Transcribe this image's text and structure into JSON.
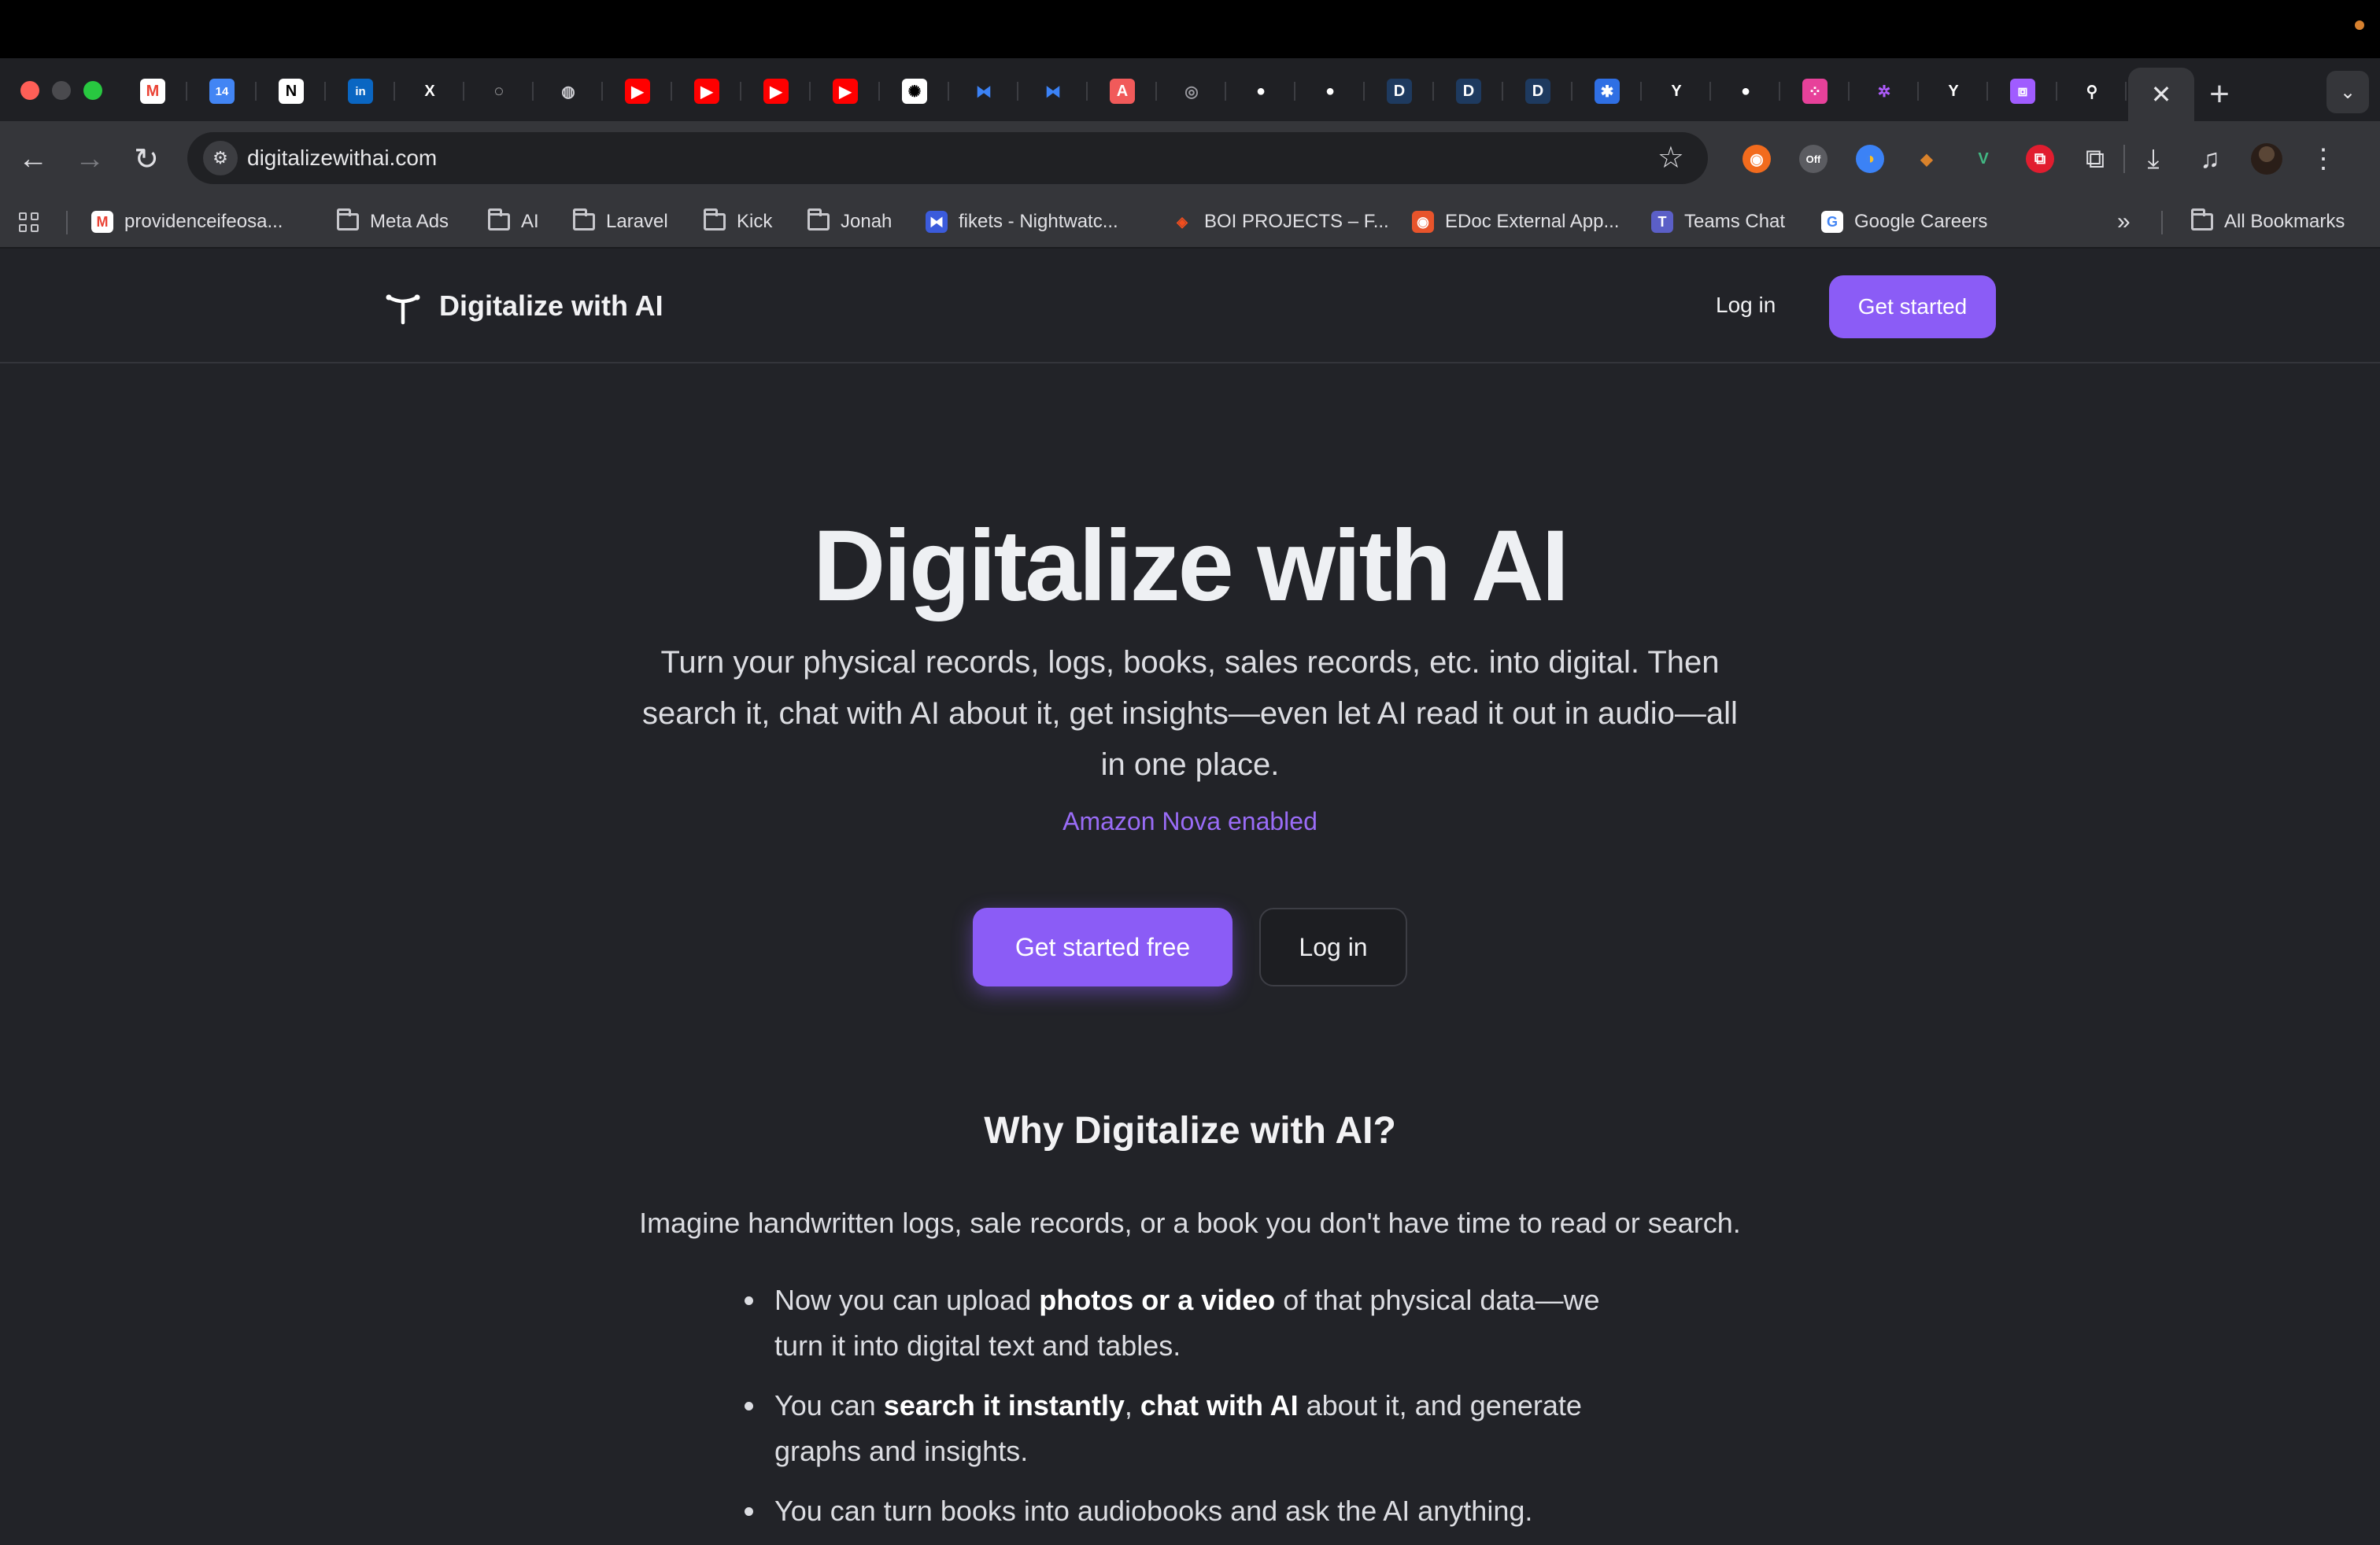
{
  "browser": {
    "active_tab_close": "✕",
    "new_tab": "+",
    "url": "digitalizewithai.com",
    "tab_favicons": [
      {
        "icon": "gmail-icon",
        "glyph": "M",
        "bg": "#ffffff",
        "fg": "#ea4335"
      },
      {
        "icon": "calendar-icon",
        "glyph": "14",
        "bg": "#4285f4",
        "fg": "#ffffff"
      },
      {
        "icon": "notion-icon",
        "glyph": "N",
        "bg": "#ffffff",
        "fg": "#000000"
      },
      {
        "icon": "linkedin-icon",
        "glyph": "in",
        "bg": "#0a66c2",
        "fg": "#ffffff"
      },
      {
        "icon": "x-icon",
        "glyph": "X",
        "bg": "transparent",
        "fg": "#ffffff"
      },
      {
        "icon": "circle-dashed-icon",
        "glyph": "◌",
        "bg": "transparent",
        "fg": "#ffffff"
      },
      {
        "icon": "globe-icon",
        "glyph": "◍",
        "bg": "transparent",
        "fg": "#cfcfd4"
      },
      {
        "icon": "youtube-icon",
        "glyph": "▶",
        "bg": "#ff0000",
        "fg": "#ffffff"
      },
      {
        "icon": "youtube-icon",
        "glyph": "▶",
        "bg": "#ff0000",
        "fg": "#ffffff"
      },
      {
        "icon": "youtube-icon",
        "glyph": "▶",
        "bg": "#ff0000",
        "fg": "#ffffff"
      },
      {
        "icon": "youtube-icon",
        "glyph": "▶",
        "bg": "#ff0000",
        "fg": "#ffffff"
      },
      {
        "icon": "openai-icon",
        "glyph": "✺",
        "bg": "#ffffff",
        "fg": "#000000"
      },
      {
        "icon": "nightwatch-icon",
        "glyph": "⧓",
        "bg": "transparent",
        "fg": "#3b82f6"
      },
      {
        "icon": "nightwatch-icon",
        "glyph": "⧓",
        "bg": "transparent",
        "fg": "#3b82f6"
      },
      {
        "icon": "acrobat-icon",
        "glyph": "A",
        "bg": "#f15a5a",
        "fg": "#ffffff"
      },
      {
        "icon": "globe-icon",
        "glyph": "◎",
        "bg": "transparent",
        "fg": "#9a9aa0"
      },
      {
        "icon": "github-icon",
        "glyph": "●",
        "bg": "transparent",
        "fg": "#ffffff"
      },
      {
        "icon": "github-icon",
        "glyph": "●",
        "bg": "transparent",
        "fg": "#ffffff"
      },
      {
        "icon": "d-icon",
        "glyph": "D",
        "bg": "#1e3a5f",
        "fg": "#ffffff"
      },
      {
        "icon": "d-icon",
        "glyph": "D",
        "bg": "#1e3a5f",
        "fg": "#ffffff"
      },
      {
        "icon": "d-icon",
        "glyph": "D",
        "bg": "#1e3a5f",
        "fg": "#ffffff"
      },
      {
        "icon": "gear-icon",
        "glyph": "✱",
        "bg": "#2f6fe4",
        "fg": "#ffffff"
      },
      {
        "icon": "digitalize-logo-icon",
        "glyph": "Y",
        "bg": "transparent",
        "fg": "#ffffff"
      },
      {
        "icon": "github-icon",
        "glyph": "●",
        "bg": "transparent",
        "fg": "#ffffff"
      },
      {
        "icon": "dots-icon",
        "glyph": "⁘",
        "bg": "#e7419a",
        "fg": "#ffffff"
      },
      {
        "icon": "sparkle-icon",
        "glyph": "✲",
        "bg": "transparent",
        "fg": "#b05cff"
      },
      {
        "icon": "digitalize-logo-icon",
        "glyph": "Y",
        "bg": "transparent",
        "fg": "#ffffff"
      },
      {
        "icon": "crop-icon",
        "glyph": "⧈",
        "bg": "#a05cff",
        "fg": "#ffffff"
      },
      {
        "icon": "link-icon",
        "glyph": "⚲",
        "bg": "transparent",
        "fg": "#ffffff"
      }
    ],
    "extensions": [
      {
        "icon": "orange-pointer-icon",
        "glyph": "◉",
        "bg": "#f26b1d",
        "fg": "#ffffff"
      },
      {
        "icon": "off-badge-icon",
        "glyph": "Off",
        "bg": "#5b5c61",
        "fg": "#ffffff"
      },
      {
        "icon": "compass-icon",
        "glyph": "◑",
        "bg": "#3b82f6",
        "fg": "#fbbf24"
      },
      {
        "icon": "fox-icon",
        "glyph": "◆",
        "bg": "transparent",
        "fg": "#d9822b"
      },
      {
        "icon": "vue-icon",
        "glyph": "V",
        "bg": "transparent",
        "fg": "#42b883"
      },
      {
        "icon": "pdf-icon",
        "glyph": "⧉",
        "bg": "#e11d2f",
        "fg": "#ffffff"
      }
    ]
  },
  "bookmarks": [
    {
      "label": "providenceifeosa...",
      "icon": "gmail-icon"
    },
    {
      "label": "Meta Ads",
      "icon": "folder-icon"
    },
    {
      "label": "AI",
      "icon": "folder-icon"
    },
    {
      "label": "Laravel",
      "icon": "folder-icon"
    },
    {
      "label": "Kick",
      "icon": "folder-icon"
    },
    {
      "label": "Jonah",
      "icon": "folder-icon"
    },
    {
      "label": "fikets - Nightwatc...",
      "icon": "nightwatch-icon"
    },
    {
      "label": "BOI PROJECTS – F...",
      "icon": "figma-icon"
    },
    {
      "label": "EDoc External App...",
      "icon": "edoc-icon"
    },
    {
      "label": "Teams Chat",
      "icon": "teams-icon"
    },
    {
      "label": "Google Careers",
      "icon": "google-icon"
    }
  ],
  "bookmarks_overflow": "»",
  "all_bookmarks": "All Bookmarks",
  "site": {
    "brand": "Digitalize with AI",
    "header_login": "Log in",
    "header_cta": "Get started",
    "hero_title": "Digitalize with AI",
    "hero_subtitle": "Turn your physical records, logs, books, sales records, etc. into digital. Then search it, chat with AI about it, get insights—even let AI read it out in audio—all in one place.",
    "nova_tagline": "Amazon Nova enabled",
    "cta_primary": "Get started free",
    "cta_secondary": "Log in",
    "why_title": "Why Digitalize with AI?",
    "why_intro": "Imagine handwritten logs, sale records, or a book you don't have time to read or search.",
    "bullets": [
      {
        "p1": "Now you can upload ",
        "b1": "photos or a video",
        "p2": " of that physical data—we turn it into digital text and tables.",
        "b2": "",
        "p3": ""
      },
      {
        "p1": "You can ",
        "b1": "search it instantly",
        "p2": ", ",
        "b2": "chat with AI",
        "p3": " about it, and generate graphs and insights."
      },
      {
        "p1": "You can turn books into audiobooks and ask the AI anything.",
        "b1": "",
        "p2": "",
        "b2": "",
        "p3": ""
      }
    ],
    "accent_color": "#8b5cf6"
  }
}
